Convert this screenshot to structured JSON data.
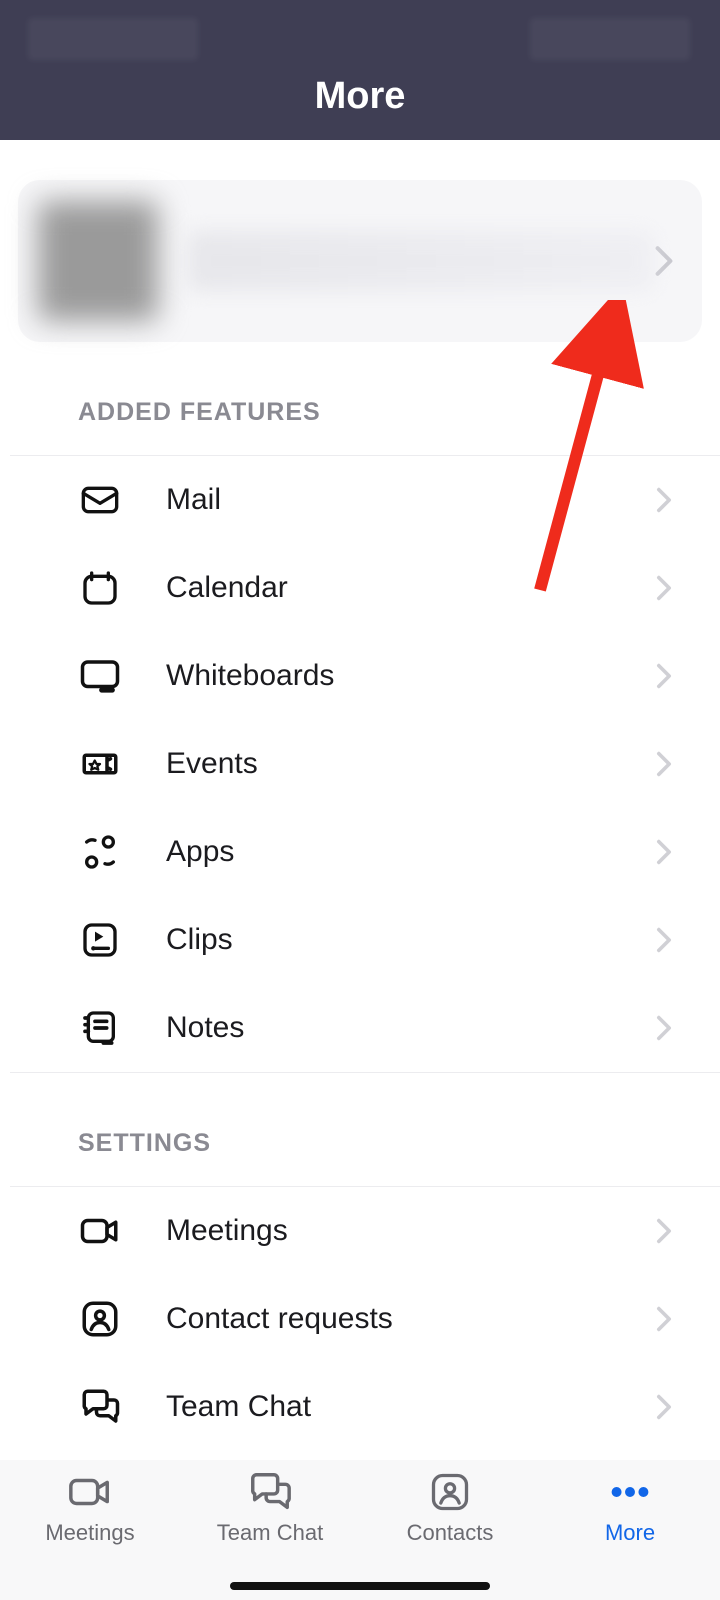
{
  "header": {
    "title": "More"
  },
  "sections": {
    "added_features": "ADDED FEATURES",
    "settings": "SETTINGS"
  },
  "features": {
    "mail": "Mail",
    "calendar": "Calendar",
    "whiteboards": "Whiteboards",
    "events": "Events",
    "apps": "Apps",
    "clips": "Clips",
    "notes": "Notes"
  },
  "settings_items": {
    "meetings": "Meetings",
    "contact_requests": "Contact requests",
    "team_chat": "Team Chat"
  },
  "tabs": {
    "meetings": "Meetings",
    "team_chat": "Team Chat",
    "contacts": "Contacts",
    "more": "More"
  }
}
